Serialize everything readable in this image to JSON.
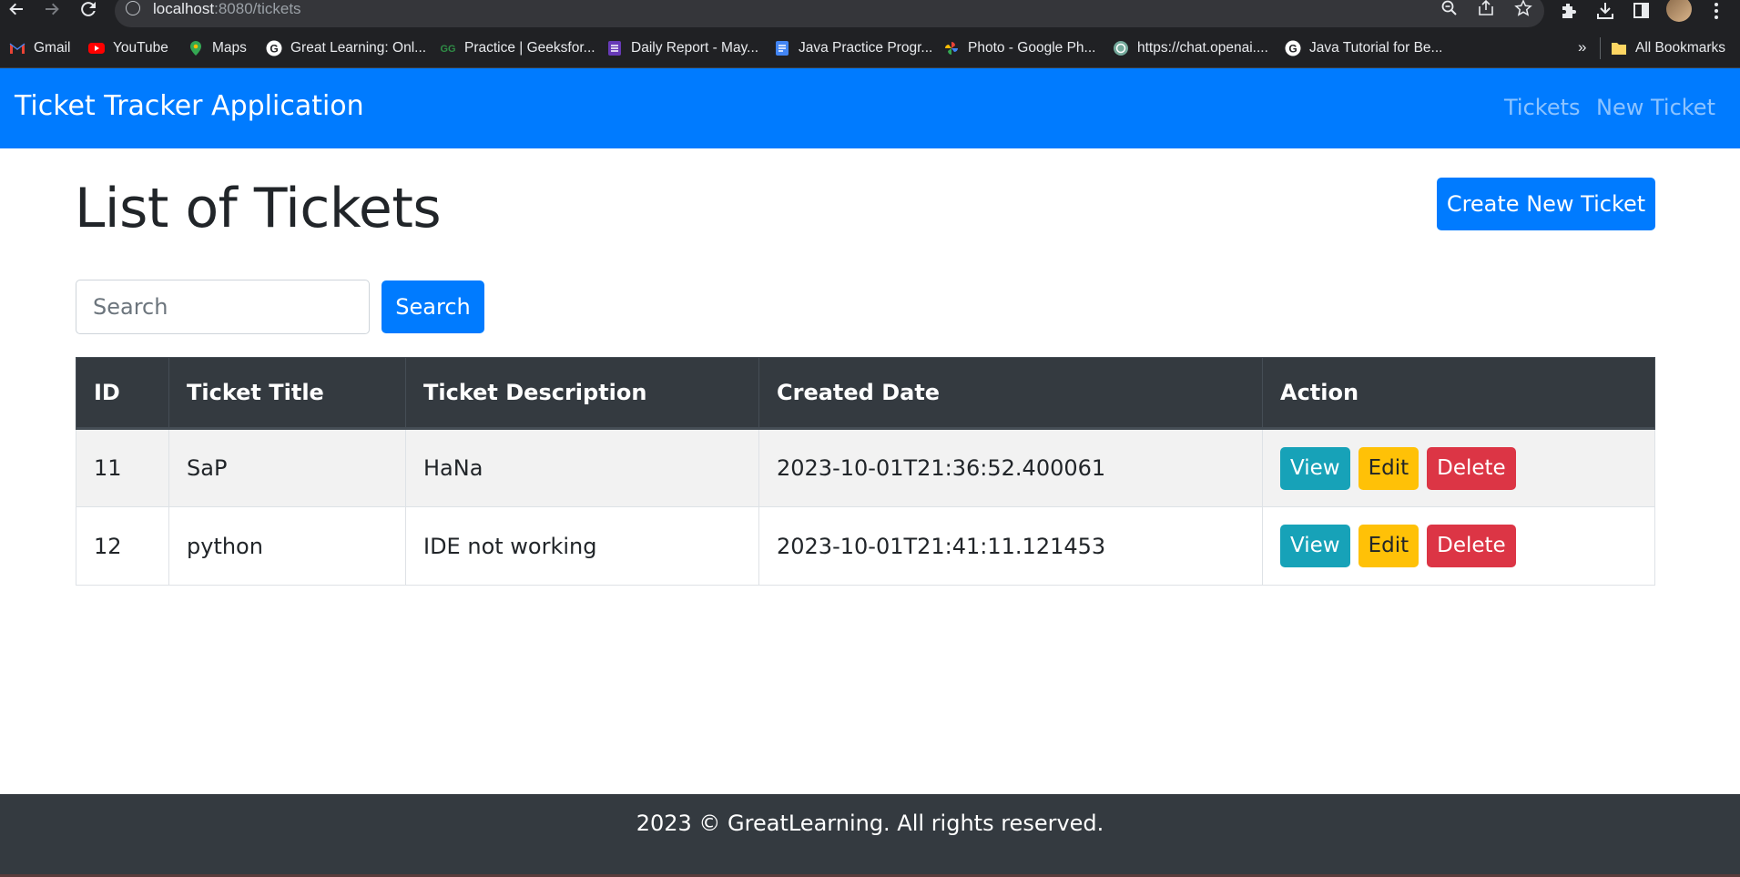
{
  "browser": {
    "url_host": "localhost",
    "url_path": ":8080/tickets",
    "bookmarks": [
      {
        "label": "Gmail",
        "icon": "gmail-icon"
      },
      {
        "label": "YouTube",
        "icon": "youtube-icon"
      },
      {
        "label": "Maps",
        "icon": "maps-icon"
      },
      {
        "label": "Great Learning: Onl...",
        "icon": "google-icon"
      },
      {
        "label": "Practice | Geeksfor...",
        "icon": "geeksforgeeks-icon"
      },
      {
        "label": "Daily Report - May...",
        "icon": "forms-icon"
      },
      {
        "label": "Java Practice Progr...",
        "icon": "docs-icon"
      },
      {
        "label": "Photo - Google Ph...",
        "icon": "photos-icon"
      },
      {
        "label": "https://chat.openai....",
        "icon": "openai-icon"
      },
      {
        "label": "Java Tutorial for Be...",
        "icon": "google-icon"
      }
    ],
    "overflow_label": "»",
    "all_bookmarks_label": "All Bookmarks"
  },
  "navbar": {
    "brand": "Ticket Tracker Application",
    "links": [
      "Tickets",
      "New Ticket"
    ],
    "bg_color": "#007bff"
  },
  "main": {
    "title": "List of Tickets",
    "create_button": "Create New Ticket",
    "search_placeholder": "Search",
    "search_button": "Search"
  },
  "table": {
    "headers": [
      "ID",
      "Ticket Title",
      "Ticket Description",
      "Created Date",
      "Action"
    ],
    "rows": [
      {
        "id": "11",
        "title": "SaP",
        "description": "HaNa",
        "created": "2023-10-01T21:36:52.400061"
      },
      {
        "id": "12",
        "title": "python",
        "description": "IDE not working",
        "created": "2023-10-01T21:41:11.121453"
      }
    ],
    "actions": {
      "view": "View",
      "edit": "Edit",
      "delete": "Delete"
    }
  },
  "footer": {
    "text": "2023 © GreatLearning. All rights reserved."
  }
}
